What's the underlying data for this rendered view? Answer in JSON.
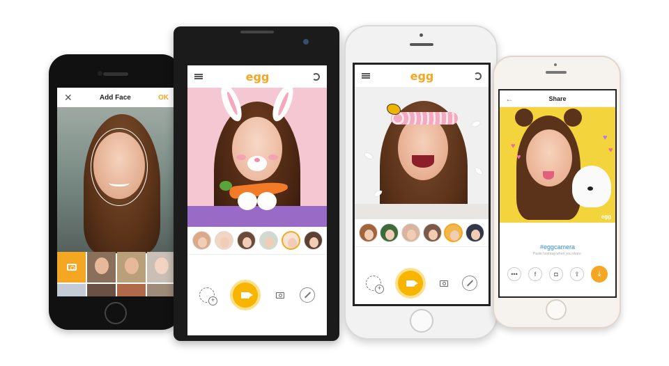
{
  "add_face": {
    "title": "Add Face",
    "confirm_label": "OK",
    "close_icon": "close-icon",
    "camera_icon": "camera-icon"
  },
  "egg_camera": {
    "logo": "egg",
    "menu_icon": "menu-icon",
    "switch_camera_icon": "switch-camera-icon",
    "record_icon": "video-camera-icon",
    "photo_icon": "photo-camera-icon",
    "add_face_icon": "add-face-icon",
    "magic_icon": "magic-wand-icon"
  },
  "share": {
    "title": "Share",
    "back_icon": "arrow-left-icon",
    "watermark": "egg",
    "hashtag": "#eggcamera",
    "hint": "Paste hashtag when you share.",
    "targets": [
      {
        "name": "line",
        "glyph": "•••"
      },
      {
        "name": "facebook",
        "glyph": "f"
      },
      {
        "name": "instagram",
        "glyph": "◘"
      },
      {
        "name": "share",
        "glyph": "⇪"
      }
    ],
    "download_glyph": "⤓"
  },
  "colors": {
    "accent": "#f5a623",
    "record": "#f7b500",
    "hashtag": "#2f8fd8"
  }
}
